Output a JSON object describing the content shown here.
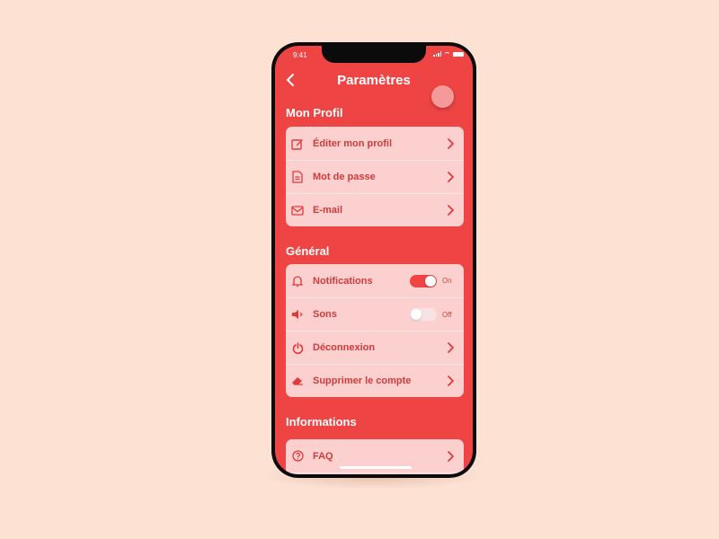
{
  "status_bar": {
    "time": "9:41"
  },
  "header": {
    "title": "Paramètres"
  },
  "sections": [
    {
      "title": "Mon Profil",
      "items": [
        {
          "label": "Éditer mon profil",
          "icon": "edit-icon",
          "control": "chevron"
        },
        {
          "label": "Mot de passe",
          "icon": "document-icon",
          "control": "chevron"
        },
        {
          "label": "E-mail",
          "icon": "mail-icon",
          "control": "chevron"
        }
      ]
    },
    {
      "title": "Général",
      "items": [
        {
          "label": "Notifications",
          "icon": "bell-icon",
          "control": "toggle",
          "state": "On"
        },
        {
          "label": "Sons",
          "icon": "speaker-icon",
          "control": "toggle",
          "state": "Off"
        },
        {
          "label": "Déconnexion",
          "icon": "power-icon",
          "control": "chevron"
        },
        {
          "label": "Supprimer le compte",
          "icon": "eraser-icon",
          "control": "chevron"
        }
      ]
    },
    {
      "title": "Informations",
      "items": [
        {
          "label": "FAQ",
          "icon": "help-icon",
          "control": "chevron"
        }
      ]
    }
  ],
  "colors": {
    "background": "#fde1d3",
    "accent": "#ef4444",
    "card": "#fdd0d0",
    "text": "#cf3b3b"
  }
}
